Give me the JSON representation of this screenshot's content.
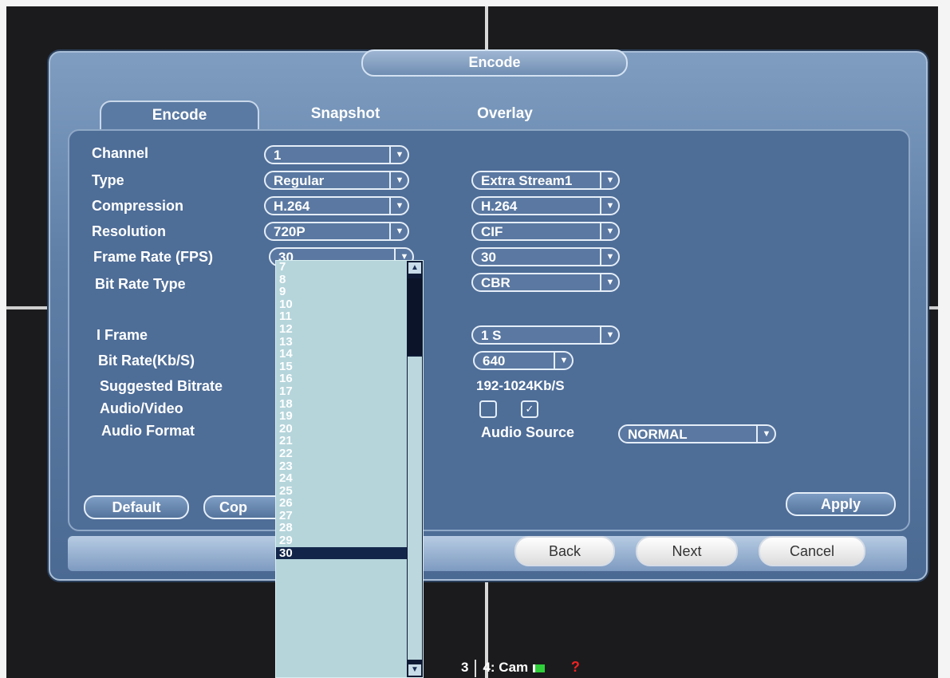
{
  "dialog": {
    "title": "Encode",
    "tabs": [
      "Encode",
      "Snapshot",
      "Overlay"
    ]
  },
  "labels": {
    "channel": "Channel",
    "type": "Type",
    "compression": "Compression",
    "resolution": "Resolution",
    "frame_rate": "Frame Rate (FPS)",
    "bit_rate_type": "Bit Rate Type",
    "i_frame": "I Frame",
    "bit_rate": "Bit Rate(Kb/S)",
    "suggested_bitrate": "Suggested Bitrate",
    "audio_video": "Audio/Video",
    "audio_format": "Audio Format",
    "audio_source": "Audio Source"
  },
  "main_stream": {
    "channel": "1",
    "type": "Regular",
    "compression": "H.264",
    "resolution": "720P",
    "frame_rate": "30"
  },
  "extra_stream": {
    "type": "Extra Stream1",
    "compression": "H.264",
    "resolution": "CIF",
    "frame_rate": "30",
    "bit_rate_type": "CBR",
    "i_frame": "1 S",
    "bit_rate": "640",
    "suggested_bitrate": "192-1024Kb/S",
    "audio_video": {
      "video_checked": false,
      "audio_checked": true
    },
    "audio_source": "NORMAL"
  },
  "frame_rate_options": [
    "7",
    "8",
    "9",
    "10",
    "11",
    "12",
    "13",
    "14",
    "15",
    "16",
    "17",
    "18",
    "19",
    "20",
    "21",
    "22",
    "23",
    "24",
    "25",
    "26",
    "27",
    "28",
    "29",
    "30"
  ],
  "frame_rate_selected": "30",
  "buttons": {
    "default": "Default",
    "copy": "Cop",
    "apply": "Apply",
    "back": "Back",
    "next": "Next",
    "cancel": "Cancel"
  },
  "status_bar": {
    "channel3": "3",
    "channel4": "4: Cam",
    "alert": "?"
  }
}
